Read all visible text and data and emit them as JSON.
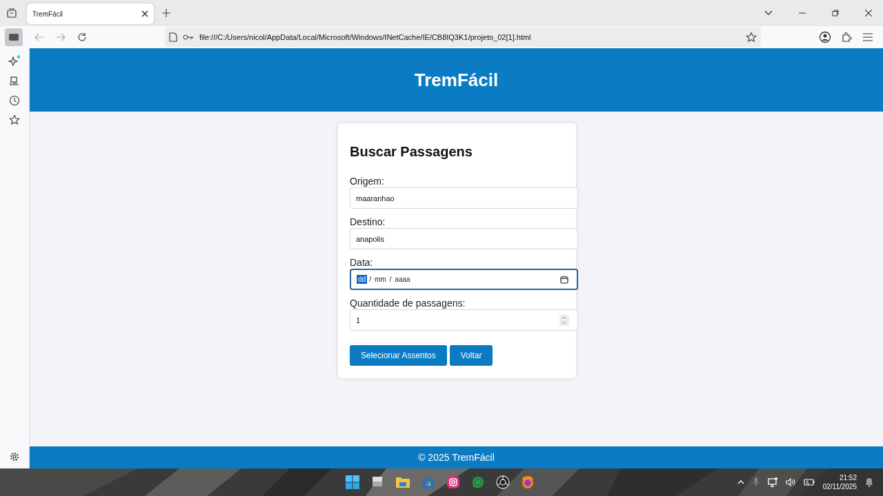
{
  "browser": {
    "tab": {
      "title": "TremFácil",
      "selected": true
    },
    "address": "file:///C:/Users/nicol/AppData/Local/Microsoft/Windows/INetCache/IE/CB8IQ3K1/projeto_02[1].html"
  },
  "page": {
    "header_title": "TremFácil",
    "form_title": "Buscar Passagens",
    "fields": [
      {
        "kind": "text",
        "label": "Origem:",
        "value": "maaranhao",
        "focused": false
      },
      {
        "kind": "text",
        "label": "Destino:",
        "value": "anapolis",
        "focused": false
      },
      {
        "kind": "date",
        "label": "Data:",
        "focused": true,
        "parts": [
          {
            "text": "dd",
            "kind": "segment",
            "selected": true
          },
          {
            "text": "/",
            "kind": "separator"
          },
          {
            "text": "mm",
            "kind": "segment",
            "selected": false
          },
          {
            "text": "/",
            "kind": "separator"
          },
          {
            "text": "aaaa",
            "kind": "segment",
            "selected": false
          }
        ]
      },
      {
        "kind": "number",
        "label": "Quantidade de passagens:",
        "value": "1",
        "focused": false
      }
    ],
    "buttons": [
      "Selecionar Assentos",
      "Voltar"
    ],
    "footer": "© 2025 TremFácil"
  },
  "taskbar": {
    "time": "21:52",
    "date": "02/11/2025"
  }
}
